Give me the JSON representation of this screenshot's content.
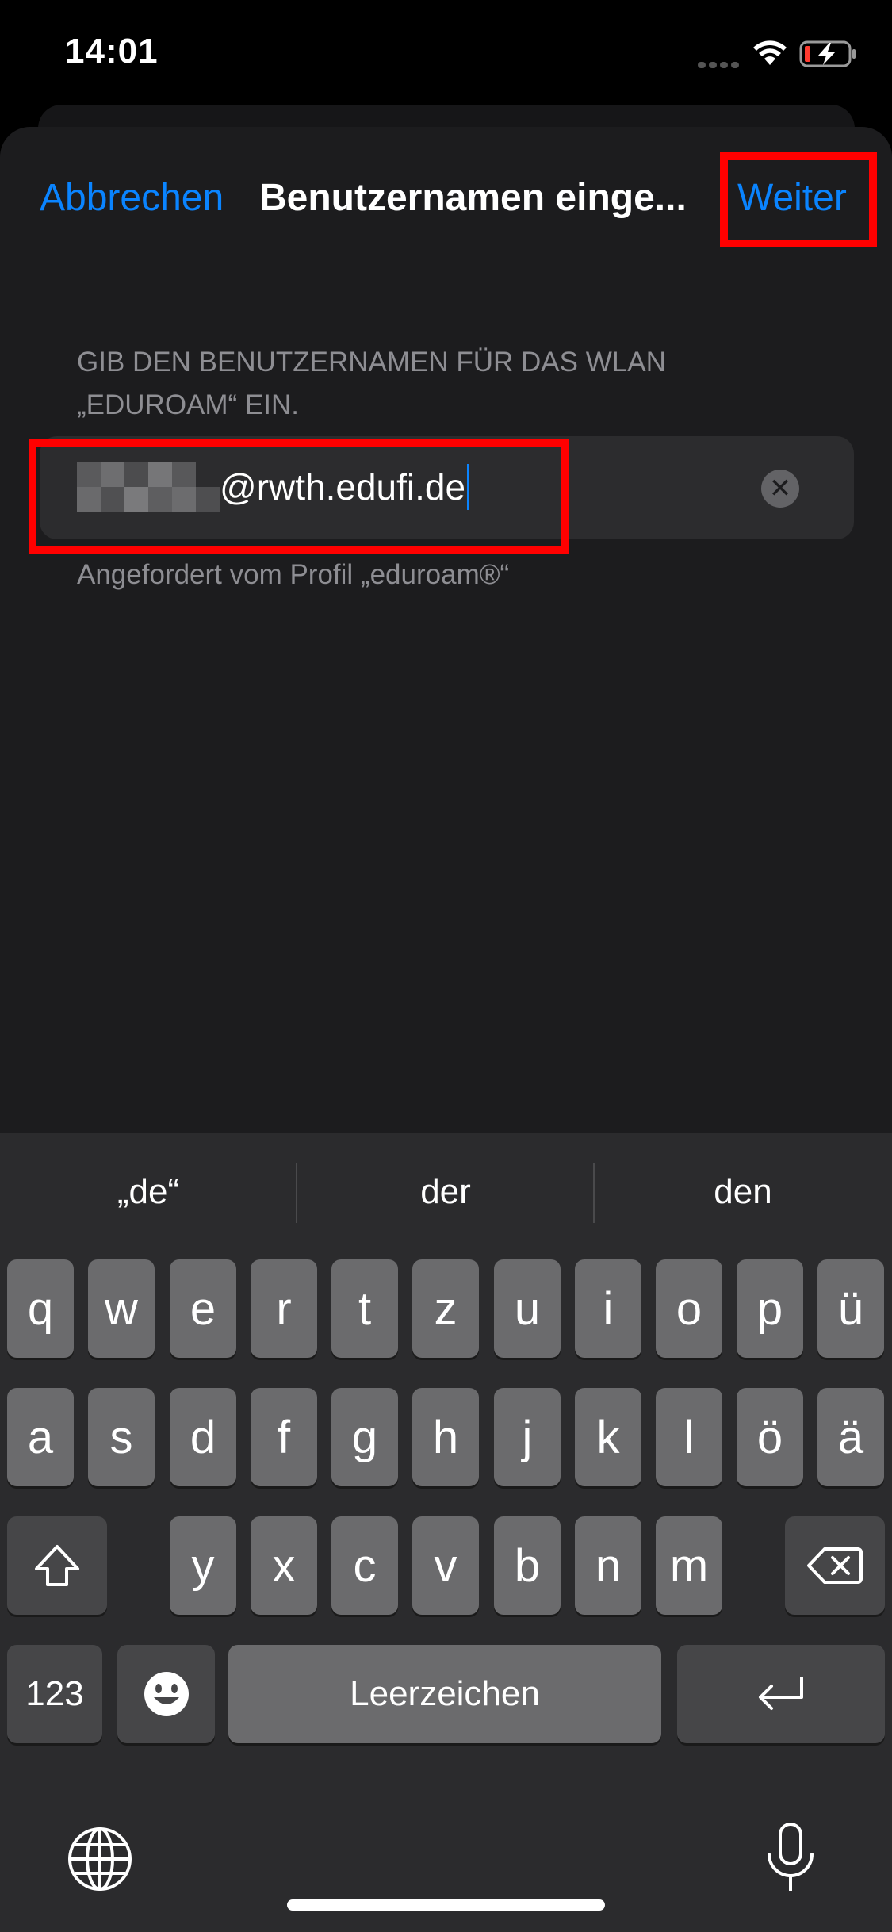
{
  "status_bar": {
    "time": "14:01"
  },
  "nav": {
    "cancel_label": "Abbrechen",
    "title": "Benutzernamen einge...",
    "next_label": "Weiter"
  },
  "form": {
    "section_header": "GIB DEN BENUTZERNAMEN FÜR DAS WLAN „EDUROAM“ EIN.",
    "input_value": "@rwth.edufi.de",
    "footer": "Angefordert vom Profil „eduroam®“"
  },
  "keyboard": {
    "suggestions": [
      "„de“",
      "der",
      "den"
    ],
    "row1": [
      "q",
      "w",
      "e",
      "r",
      "t",
      "z",
      "u",
      "i",
      "o",
      "p",
      "ü"
    ],
    "row2": [
      "a",
      "s",
      "d",
      "f",
      "g",
      "h",
      "j",
      "k",
      "l",
      "ö",
      "ä"
    ],
    "row3": [
      "y",
      "x",
      "c",
      "v",
      "b",
      "n",
      "m"
    ],
    "numbers_label": "123",
    "space_label": "Leerzeichen"
  },
  "colors": {
    "accent": "#0a84ff",
    "highlight": "#ff0000"
  }
}
